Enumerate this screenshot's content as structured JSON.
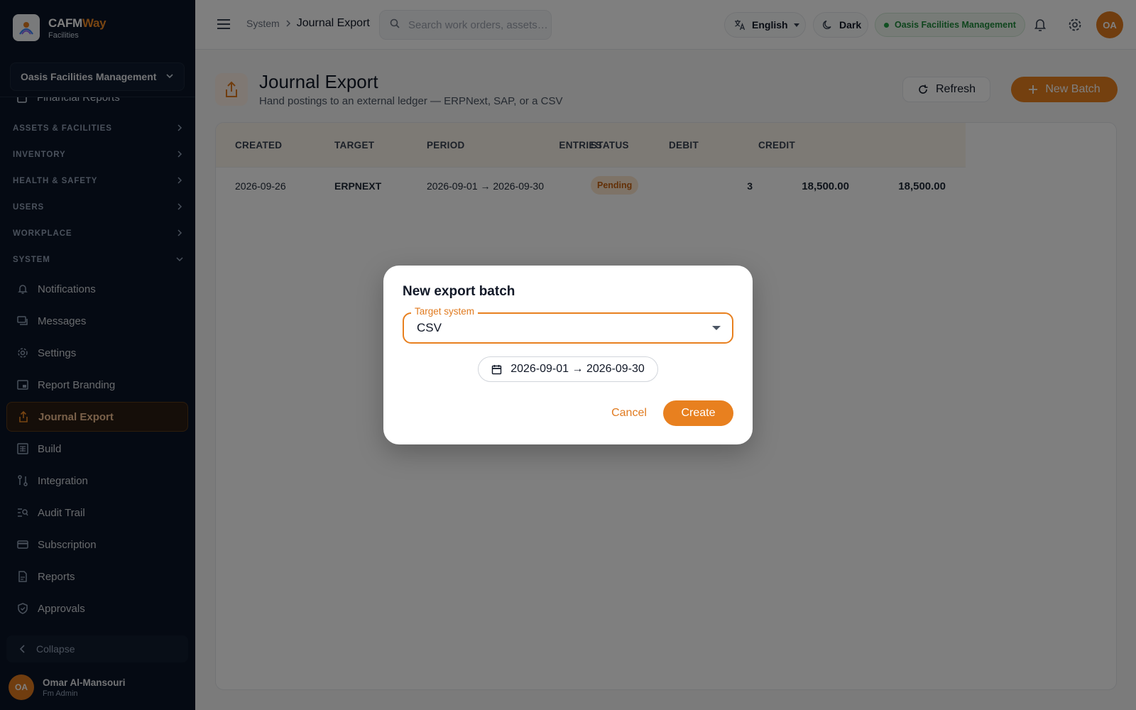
{
  "brand": {
    "name_part1": "CAFM",
    "name_part2": "Way",
    "subtitle": "Facilities"
  },
  "org_selector": {
    "value": "Oasis Facilities Management"
  },
  "sidebar": {
    "cut_item": "Financial Reports",
    "sections": [
      {
        "label": "ASSETS & FACILITIES"
      },
      {
        "label": "INVENTORY"
      },
      {
        "label": "HEALTH & SAFETY"
      },
      {
        "label": "USERS"
      },
      {
        "label": "WORKPLACE"
      },
      {
        "label": "SYSTEM"
      }
    ],
    "items": [
      {
        "label": "Notifications",
        "icon": "bell-icon"
      },
      {
        "label": "Messages",
        "icon": "chat-icon"
      },
      {
        "label": "Settings",
        "icon": "gear-icon"
      },
      {
        "label": "Report Branding",
        "icon": "branding-icon"
      },
      {
        "label": "Journal Export",
        "icon": "export-icon",
        "active": true
      },
      {
        "label": "Build",
        "icon": "build-icon"
      },
      {
        "label": "Integration",
        "icon": "integration-icon"
      },
      {
        "label": "Audit Trail",
        "icon": "audit-icon"
      },
      {
        "label": "Subscription",
        "icon": "card-icon"
      },
      {
        "label": "Reports",
        "icon": "report-icon"
      },
      {
        "label": "Approvals",
        "icon": "shield-icon"
      }
    ],
    "collapse_label": "Collapse",
    "user": {
      "initials": "OA",
      "name": "Omar Al-Mansouri",
      "role": "Fm Admin"
    }
  },
  "topbar": {
    "breadcrumb": {
      "parent": "System",
      "current": "Journal Export"
    },
    "search_placeholder": "Search work orders, assets…",
    "language": "English",
    "theme": "Dark",
    "org_badge": "Oasis Facilities Management",
    "avatar_initials": "OA"
  },
  "page": {
    "title": "Journal Export",
    "subtitle": "Hand postings to an external ledger — ERPNext, SAP, or a CSV",
    "refresh_label": "Refresh",
    "new_batch_label": "New Batch"
  },
  "table": {
    "columns": [
      "CREATED",
      "TARGET",
      "PERIOD",
      "STATUS",
      "ENTRIES",
      "DEBIT",
      "CREDIT"
    ],
    "rows": [
      {
        "created": "2026-09-26",
        "target": "ERPNEXT",
        "period": "2026-09-01 → 2026-09-30",
        "status": "Pending",
        "entries": "3",
        "debit": "18,500.00",
        "credit": "18,500.00"
      }
    ]
  },
  "modal": {
    "title": "New export batch",
    "target_label": "Target system",
    "target_value": "CSV",
    "date_range": "2026-09-01 → 2026-09-30",
    "cancel_label": "Cancel",
    "create_label": "Create"
  },
  "colors": {
    "accent": "#e8801f",
    "sidebar_bg": "#0b1526",
    "success": "#1f8a3a"
  }
}
